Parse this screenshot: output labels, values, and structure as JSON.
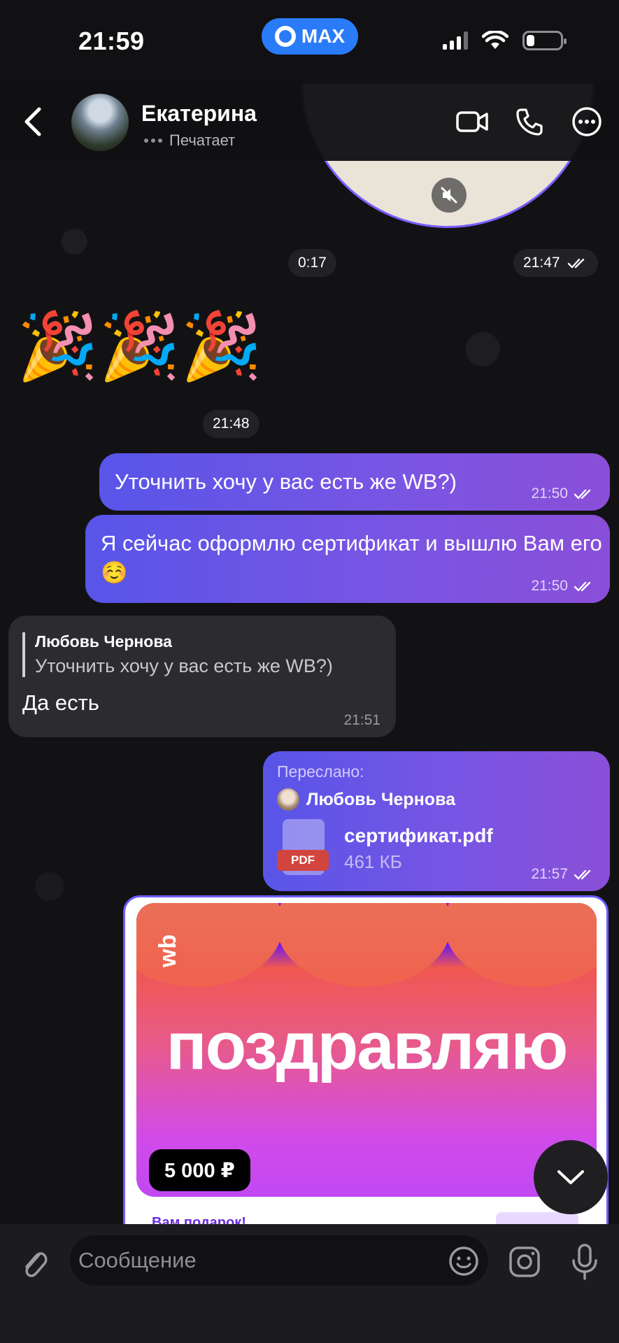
{
  "status_bar": {
    "time": "21:59",
    "app_pill": "MAX",
    "battery_percent": 24
  },
  "header": {
    "contact_name": "Екатерина",
    "status": "Печатает"
  },
  "messages": {
    "video_duration": "0:17",
    "video_time": "21:47",
    "emoji": "🎉🎉🎉",
    "emoji_time": "21:48",
    "m1_text": "Уточнить хочу у вас есть же WB?)",
    "m1_time": "21:50",
    "m2_text": "Я сейчас оформлю сертификат и вышлю Вам его☺️",
    "m2_time": "21:50",
    "m3_quote_name": "Любовь Чернова",
    "m3_quote_text": "Уточнить хочу у вас есть же WB?)",
    "m3_text": "Да есть",
    "m3_time": "21:51",
    "m4_forward_label": "Переслано:",
    "m4_author": "Любовь Чернова",
    "m4_file_type": "PDF",
    "m4_file_name": "сертификат.pdf",
    "m4_file_size": "461 КБ",
    "m4_time": "21:57"
  },
  "certificate": {
    "logo": "wb",
    "title": "поздравляю",
    "amount": "5 000 ₽",
    "subtitle": "Вам подарок!"
  },
  "composer": {
    "placeholder": "Сообщение"
  },
  "colors": {
    "outgoing_start": "#5855e8",
    "outgoing_end": "#8a4fd8",
    "incoming": "#2b2b30",
    "accent": "#2a7bf7"
  }
}
